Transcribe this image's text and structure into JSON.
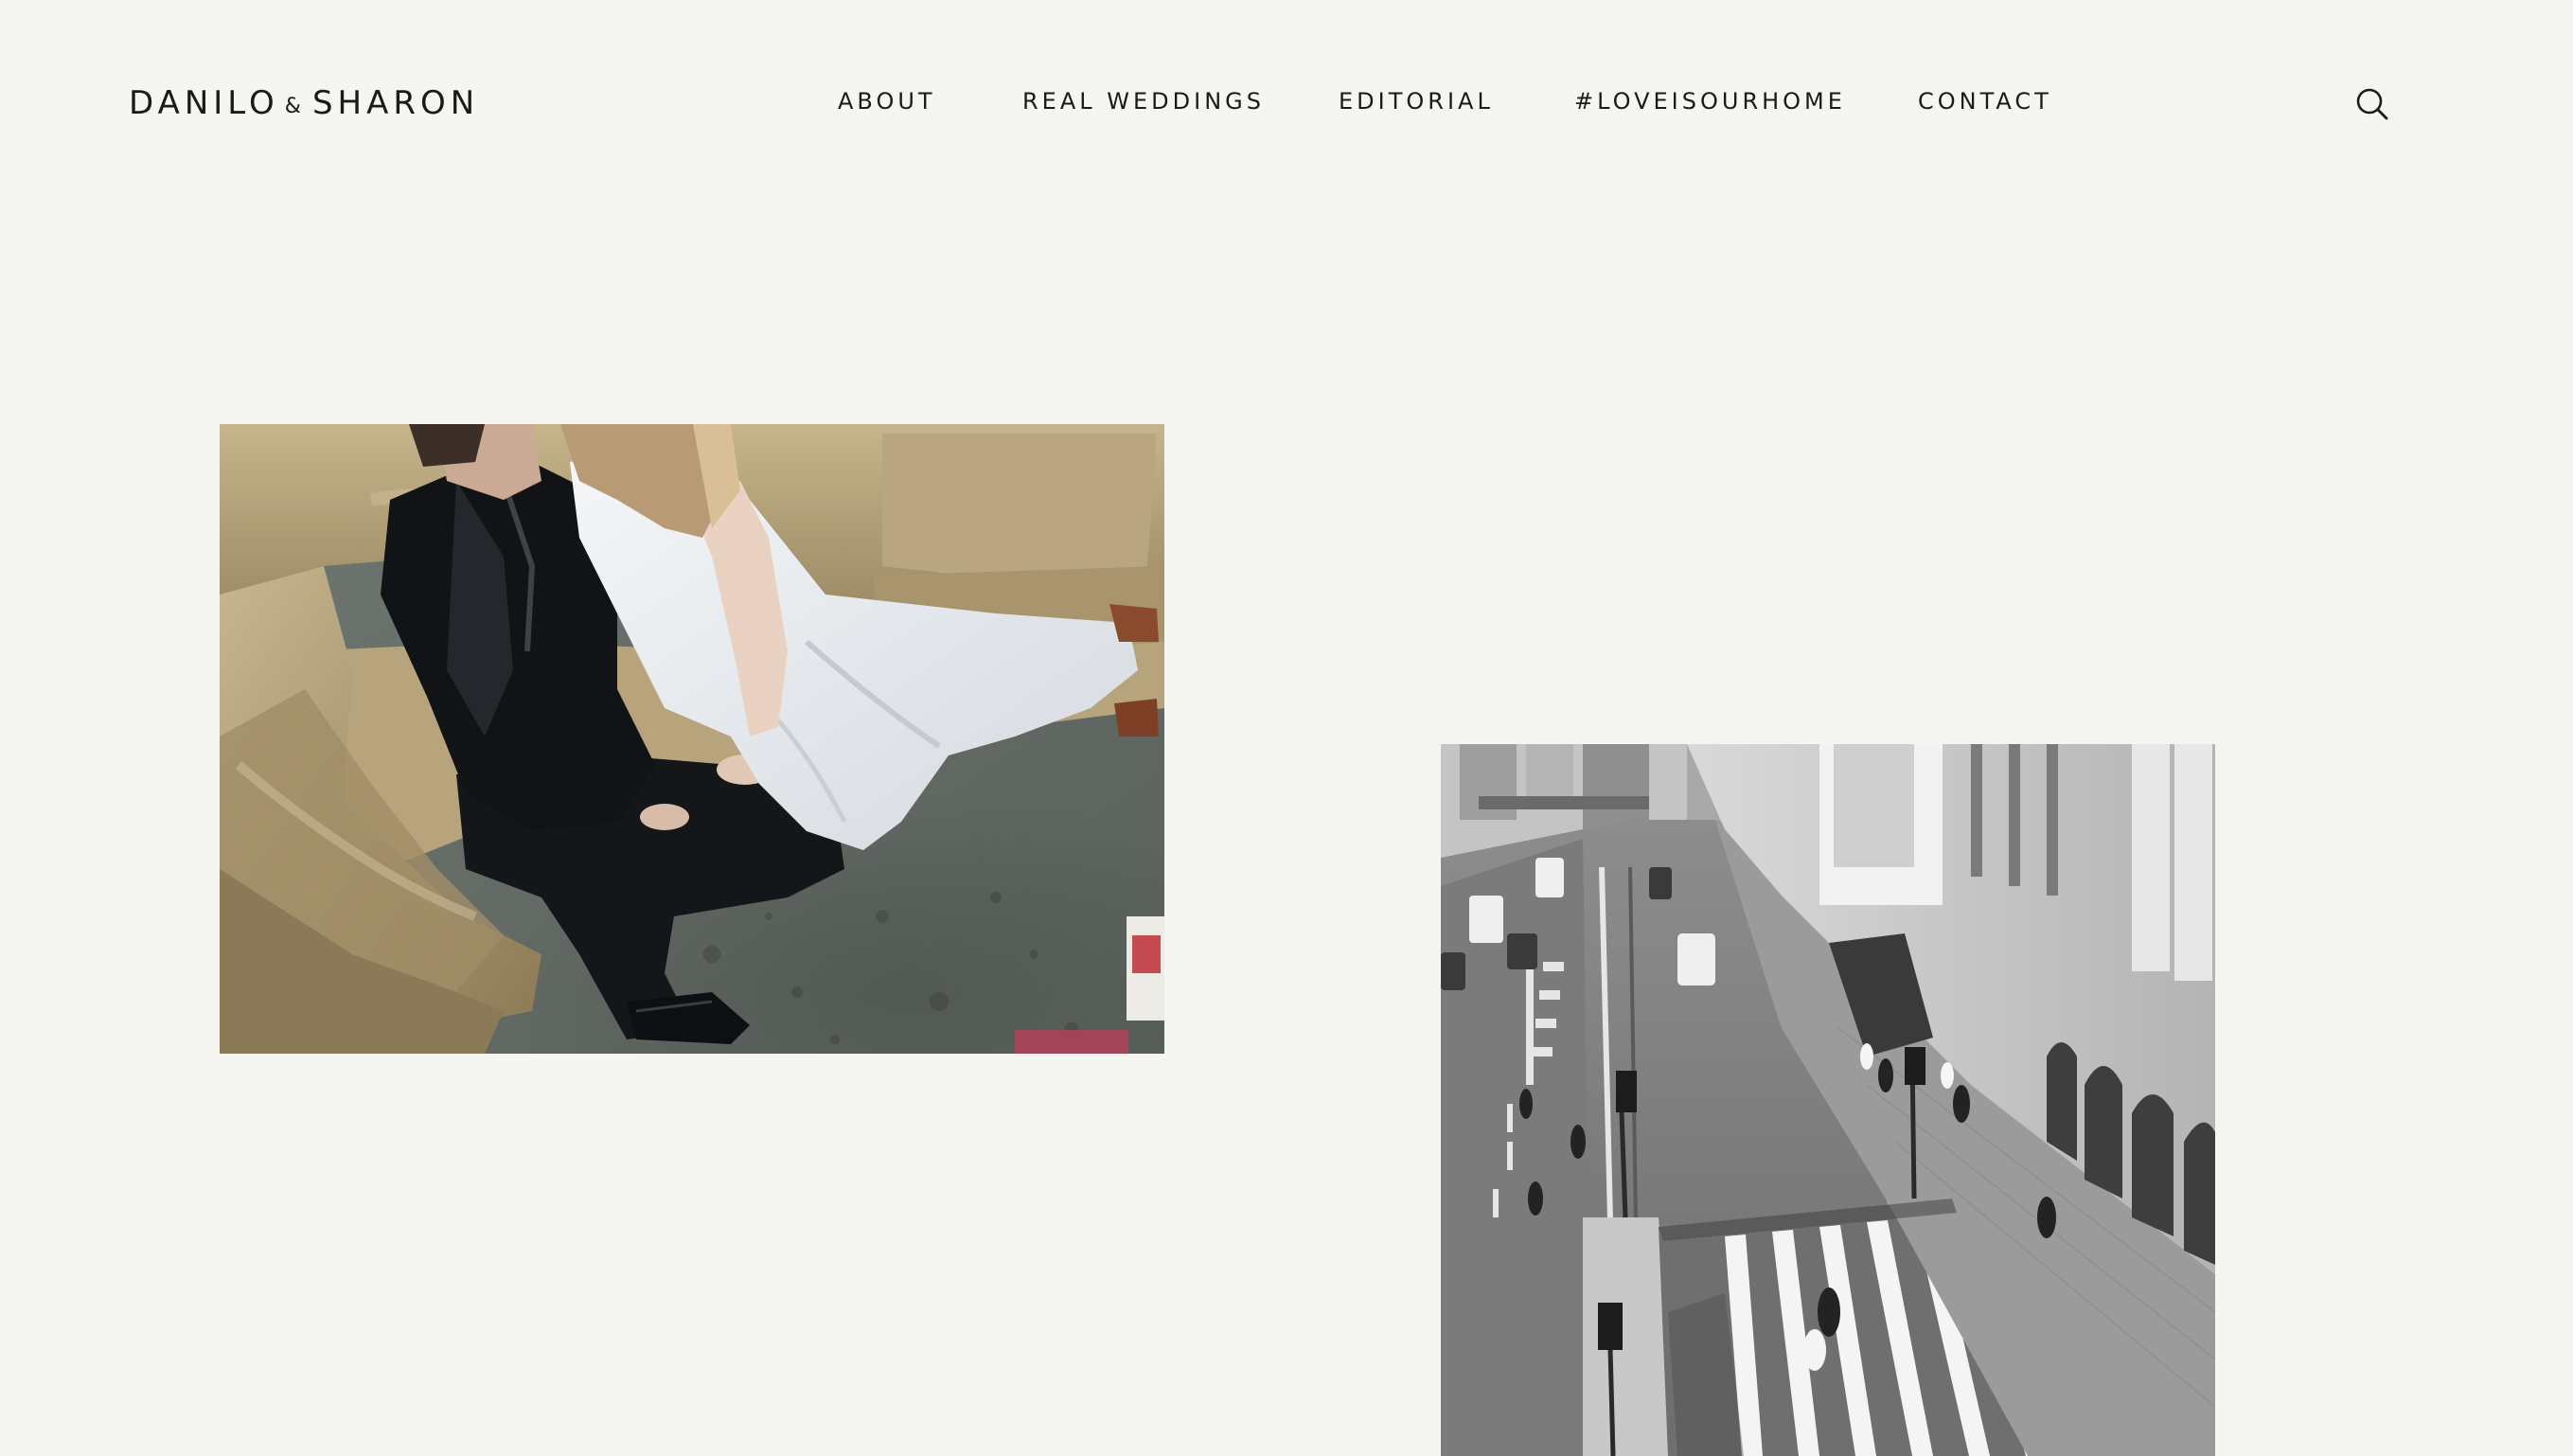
{
  "site": {
    "logo": {
      "left_name": "DANILO",
      "ampersand": "&",
      "right_name": "SHARON"
    }
  },
  "nav": {
    "items": [
      {
        "label": "ABOUT"
      },
      {
        "label": "REAL WEDDINGS"
      },
      {
        "label": "EDITORIAL"
      },
      {
        "label": "#LOVEISOURHOME"
      },
      {
        "label": "CONTACT"
      }
    ],
    "search_icon": "search-icon"
  },
  "gallery": {
    "photos": [
      {
        "subject": "couple-on-velvet-sofa",
        "tone": "color"
      },
      {
        "subject": "city-street-crosswalk",
        "tone": "black-and-white"
      }
    ]
  },
  "colors": {
    "background": "#f5f6f1",
    "text": "#1a1a1a"
  }
}
